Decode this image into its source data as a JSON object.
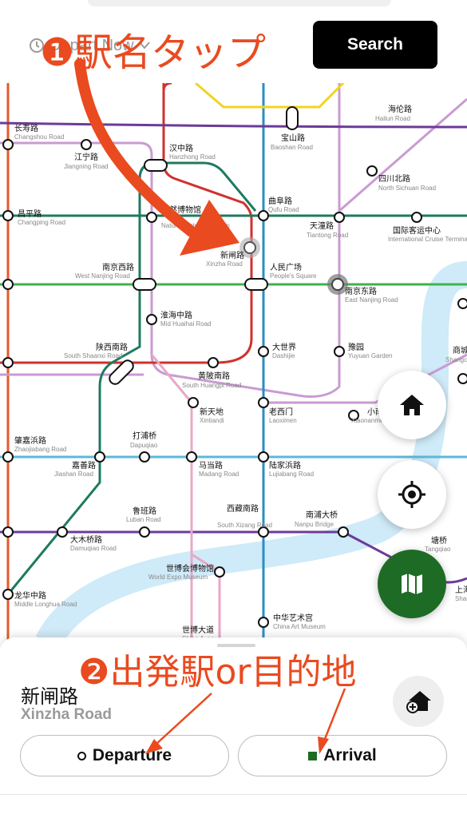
{
  "header": {
    "time_picker_label": "Depart Now",
    "search_label": "Search"
  },
  "annotations": {
    "step1": "❶駅名タップ",
    "step2": "❷出発駅or目的地"
  },
  "map": {
    "stations": [
      {
        "cn": "长寿路",
        "en": "Changshou Road"
      },
      {
        "cn": "江宁路",
        "en": "Jiangning Road"
      },
      {
        "cn": "汉中路",
        "en": "Hanzhong Road"
      },
      {
        "cn": "宝山路",
        "en": "Baoshan Road"
      },
      {
        "cn": "海伦路",
        "en": "Hailun Road"
      },
      {
        "cn": "四川北路",
        "en": "North Sichuan Road"
      },
      {
        "cn": "昌平路",
        "en": "Changping Road"
      },
      {
        "cn": "自然博物馆",
        "en": "Natural History Museum"
      },
      {
        "cn": "曲阜路",
        "en": "Qufu Road"
      },
      {
        "cn": "天潼路",
        "en": "Tiantong Road"
      },
      {
        "cn": "国际客运中心",
        "en": "International Cruise Terminal"
      },
      {
        "cn": "新闸路",
        "en": "Xinzha Road"
      },
      {
        "cn": "南京西路",
        "en": "West Nanjing Road"
      },
      {
        "cn": "人民广场",
        "en": "People's Square"
      },
      {
        "cn": "南京东路",
        "en": "East Nanjing Road"
      },
      {
        "cn": "淮海中路",
        "en": "Mid Huaihai Road"
      },
      {
        "cn": "陕西南路",
        "en": "South Shaanxi Road"
      },
      {
        "cn": "大世界",
        "en": "Dashijie"
      },
      {
        "cn": "豫园",
        "en": "Yuyuan Garden"
      },
      {
        "cn": "商城",
        "en": "Shangcheng"
      },
      {
        "cn": "黄陂南路",
        "en": "South Huangpi Road"
      },
      {
        "cn": "新天地",
        "en": "Xintiandi"
      },
      {
        "cn": "老西门",
        "en": "Laoximen"
      },
      {
        "cn": "小南门",
        "en": "Xiaonanmen"
      },
      {
        "cn": "肇嘉浜路",
        "en": "Zhaojiabang Road"
      },
      {
        "cn": "打浦桥",
        "en": "Dapuqiao"
      },
      {
        "cn": "嘉善路",
        "en": "Jiashan Road"
      },
      {
        "cn": "马当路",
        "en": "Madang Road"
      },
      {
        "cn": "陆家浜路",
        "en": "Lujiabang Road"
      },
      {
        "cn": "鲁班路",
        "en": "Luban Road"
      },
      {
        "cn": "西藏南路",
        "en": "South Xizang Road"
      },
      {
        "cn": "南浦大桥",
        "en": "Nanpu Bridge"
      },
      {
        "cn": "大木桥路",
        "en": "Damuqiao Road"
      },
      {
        "cn": "塘桥",
        "en": "Tangqiao"
      },
      {
        "cn": "世博会博物馆",
        "en": "World Expo Museum"
      },
      {
        "cn": "龙华中路",
        "en": "Middle Longhua Road"
      },
      {
        "cn": "中华艺术宫",
        "en": "China Art Museum"
      },
      {
        "cn": "世博大道",
        "en": "Shibo Avenue"
      },
      {
        "cn": "上海",
        "en": "Shanghai"
      }
    ]
  },
  "sheet": {
    "station_cn": "新闸路",
    "station_en": "Xinzha Road",
    "departure_label": "Departure",
    "arrival_label": "Arrival"
  },
  "colors": {
    "accent_green": "#1e6b26",
    "annotation": "#ea4a1f",
    "button_dark": "#000000"
  }
}
